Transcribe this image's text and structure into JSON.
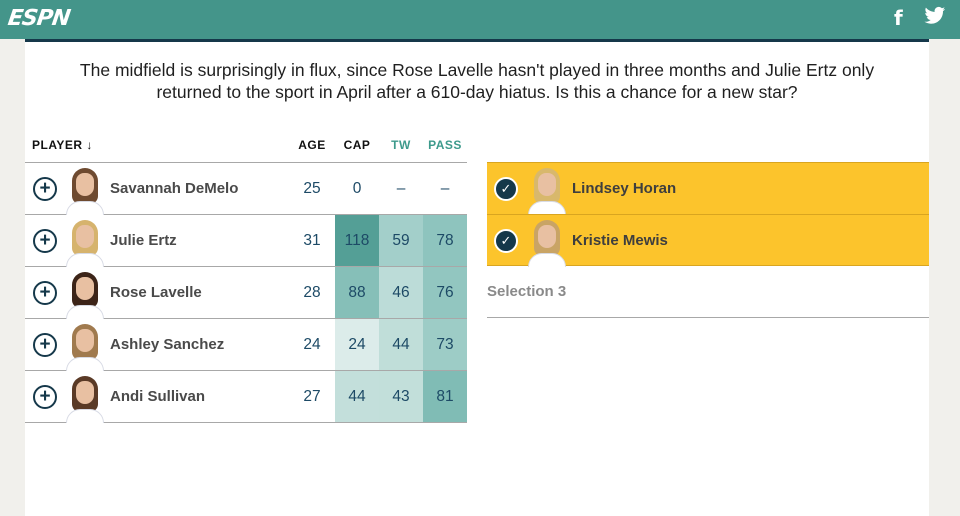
{
  "header": {
    "logo": "ESPN",
    "facebook_glyph": "f",
    "twitter_glyph": "🐦",
    "bg_color": "#44958a"
  },
  "intro": "The midfield is surprisingly in flux, since Rose Lavelle hasn't played in three months and Julie Ertz only returned to the sport in April after a 610-day hiatus. Is this a chance for a new star?",
  "table": {
    "columns": {
      "player": "PLAYER ↓",
      "age": "AGE",
      "cap": "CAP",
      "tw": "TW",
      "pass": "PASS"
    },
    "rows": [
      {
        "name": "Savannah DeMelo",
        "age": "25",
        "cap": "0",
        "tw": "–",
        "pass": "–",
        "hair": "#6e4a30"
      },
      {
        "name": "Julie Ertz",
        "age": "31",
        "cap": "118",
        "tw": "59",
        "pass": "78",
        "hair": "#d6b36d"
      },
      {
        "name": "Rose Lavelle",
        "age": "28",
        "cap": "88",
        "tw": "46",
        "pass": "76",
        "hair": "#3c2418"
      },
      {
        "name": "Ashley Sanchez",
        "age": "24",
        "cap": "24",
        "tw": "44",
        "pass": "73",
        "hair": "#a07a4e"
      },
      {
        "name": "Andi Sullivan",
        "age": "27",
        "cap": "44",
        "tw": "43",
        "pass": "81",
        "hair": "#5a3a26"
      }
    ]
  },
  "selections": [
    {
      "name": "Lindsey Horan",
      "hair": "#d8b86c"
    },
    {
      "name": "Kristie Mewis",
      "hair": "#c9a465"
    },
    {
      "label": "Selection 3"
    }
  ],
  "icons": {
    "add": "+",
    "check": "✓"
  },
  "colors": {
    "accent": "#44958a",
    "selected": "#fcc42c",
    "button": "#15384a"
  }
}
